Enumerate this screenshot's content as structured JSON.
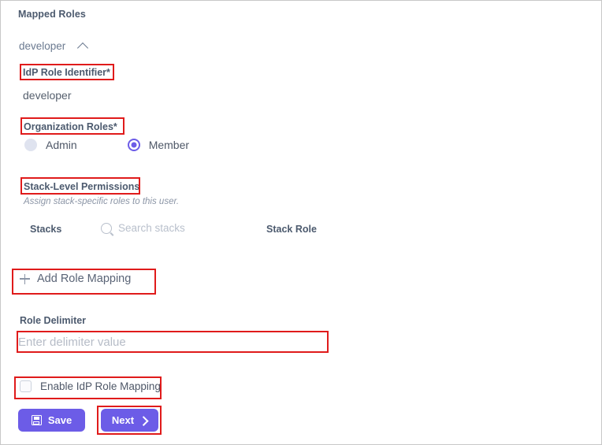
{
  "panel": {
    "heading": "Mapped Roles"
  },
  "accordion": {
    "label": "developer",
    "chevron_icon": "chevron-up-icon",
    "expanded": true
  },
  "idp_role_identifier": {
    "label": "IdP Role Identifier*",
    "value": "developer"
  },
  "organization_roles": {
    "label": "Organization Roles*",
    "options": [
      {
        "label": "Admin",
        "selected": false
      },
      {
        "label": "Member",
        "selected": true
      }
    ]
  },
  "stack_level_permissions": {
    "label": "Stack-Level Permissions",
    "helper": "Assign stack-specific roles to this user.",
    "columns": {
      "stacks": "Stacks",
      "stack_role": "Stack Role"
    },
    "search": {
      "placeholder": "Search stacks",
      "value": "",
      "icon": "search-icon"
    },
    "rows": []
  },
  "add_role_mapping": {
    "label": "Add Role Mapping",
    "icon": "plus-icon"
  },
  "role_delimiter": {
    "label": "Role Delimiter",
    "placeholder": "Enter delimiter value",
    "value": ""
  },
  "enable_idp_role_mapping": {
    "label": "Enable IdP Role Mapping",
    "checked": false
  },
  "buttons": {
    "save": {
      "label": "Save",
      "icon": "floppy-disk-icon"
    },
    "next": {
      "label": "Next",
      "icon": "chevron-right-icon"
    }
  },
  "colors": {
    "accent": "#6c5ce7",
    "annotation": "#e01b1b",
    "label_text": "#4c5a6e",
    "placeholder": "#b6bcc7"
  }
}
